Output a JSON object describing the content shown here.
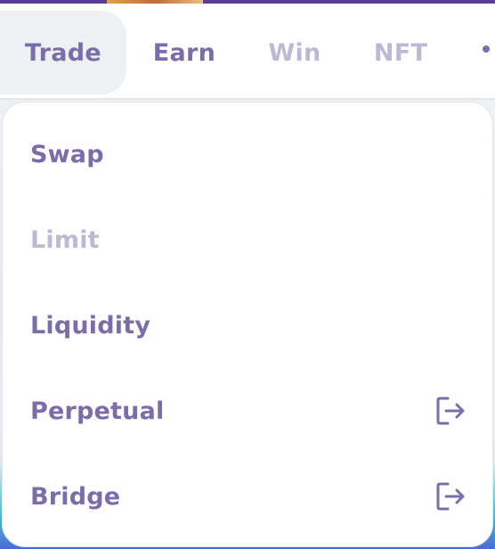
{
  "nav": {
    "items": [
      {
        "label": "Trade",
        "state": "active"
      },
      {
        "label": "Earn",
        "state": "enabled"
      },
      {
        "label": "Win",
        "state": "disabled"
      },
      {
        "label": "NFT",
        "state": "disabled"
      }
    ],
    "more_icon": "more-dots-icon"
  },
  "menu": {
    "items": [
      {
        "label": "Swap",
        "state": "enabled"
      },
      {
        "label": "Limit",
        "state": "disabled"
      },
      {
        "label": "Liquidity",
        "state": "enabled"
      },
      {
        "label": "Perpetual",
        "state": "enabled",
        "icon": "external-link-icon"
      },
      {
        "label": "Bridge",
        "state": "enabled",
        "icon": "external-link-icon"
      }
    ]
  },
  "colors": {
    "text_primary": "#7a6eaa",
    "text_disabled": "#bdb8d4",
    "active_tab_bg": "#eef1f4",
    "border": "#e7e3eb",
    "top_strip": "#5b3f8f"
  }
}
